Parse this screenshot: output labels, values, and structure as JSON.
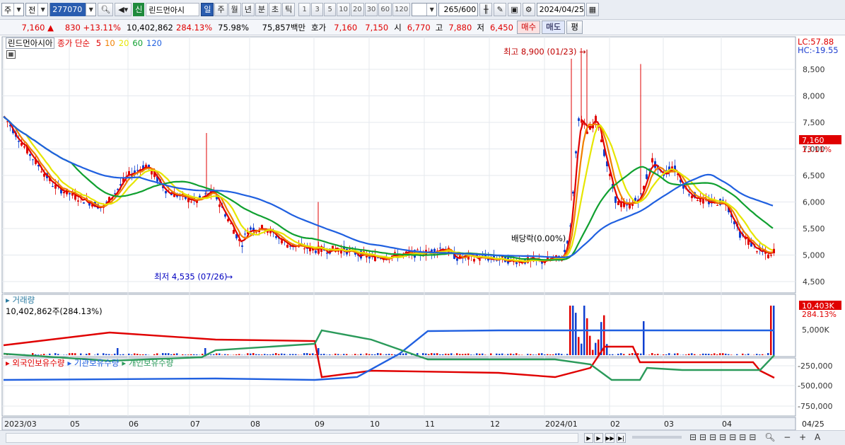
{
  "toolbar": {
    "type_label": "주",
    "prev_label": "전",
    "code": "277070",
    "new_badge": "신",
    "stock_name": "린드먼아시",
    "periods": [
      "일",
      "주",
      "월",
      "년",
      "분",
      "초",
      "틱"
    ],
    "active_period": "일",
    "minutes": [
      "1",
      "3",
      "5",
      "10",
      "20",
      "30",
      "60",
      "120"
    ],
    "count": "265",
    "count_total": "/600",
    "date": "2024/04/25"
  },
  "quote": {
    "price": "7,160",
    "arrow": "▲",
    "change": "830",
    "change_pct": "+13.11%",
    "volume": "10,402,862",
    "volume_ratio": "284.13%",
    "turnover": "75.98%",
    "amount": "75,857백만",
    "hoga_label": "호가",
    "hoga_ask": "7,160",
    "hoga_bid": "7,150",
    "open_label": "시",
    "open": "6,770",
    "high_label": "고",
    "high": "7,880",
    "low_label": "저",
    "low": "6,450",
    "buy_label": "매수",
    "sell_label": "매도",
    "eval_label": "평"
  },
  "price_panel": {
    "name": "린드먼아시아",
    "legend_prefix": "종가 단순",
    "ma": [
      {
        "period": "5",
        "color": "#e00000"
      },
      {
        "period": "10",
        "color": "#f08000"
      },
      {
        "period": "20",
        "color": "#e6e600"
      },
      {
        "period": "60",
        "color": "#10a030"
      },
      {
        "period": "120",
        "color": "#2060e0"
      }
    ],
    "lc": "LC:57.88",
    "hc": "HC:-19.55",
    "price_tag": "7,160",
    "pct_tag": "13.11%",
    "annot_high": "최고 8,900 (01/23) →",
    "annot_low": "최저 4,535 (07/26)",
    "annot_div": "배당락(0.00%)",
    "y_ticks": [
      "8,500",
      "8,000",
      "7,500",
      "7,000",
      "6,500",
      "6,000",
      "5,500",
      "5,000",
      "4,500"
    ]
  },
  "volume_panel": {
    "name": "거래량",
    "value": "10,402,862주(284.13%)",
    "tag": "10,403K",
    "tag_pct": "284.13%",
    "y_tick": "5,000K"
  },
  "holdings_panel": {
    "series": [
      {
        "name": "외국인보유수량",
        "color": "#e00000"
      },
      {
        "name": "기관보유수량",
        "color": "#2060e0"
      },
      {
        "name": "개인보유수량",
        "color": "#2a9a5a"
      }
    ],
    "y_ticks": [
      "-250,000",
      "-500,000",
      "-750,000"
    ]
  },
  "x_axis": [
    "2023/03",
    "05",
    "06",
    "07",
    "08",
    "09",
    "10",
    "11",
    "12",
    "2024/01",
    "02",
    "03",
    "04",
    "04/25"
  ]
}
